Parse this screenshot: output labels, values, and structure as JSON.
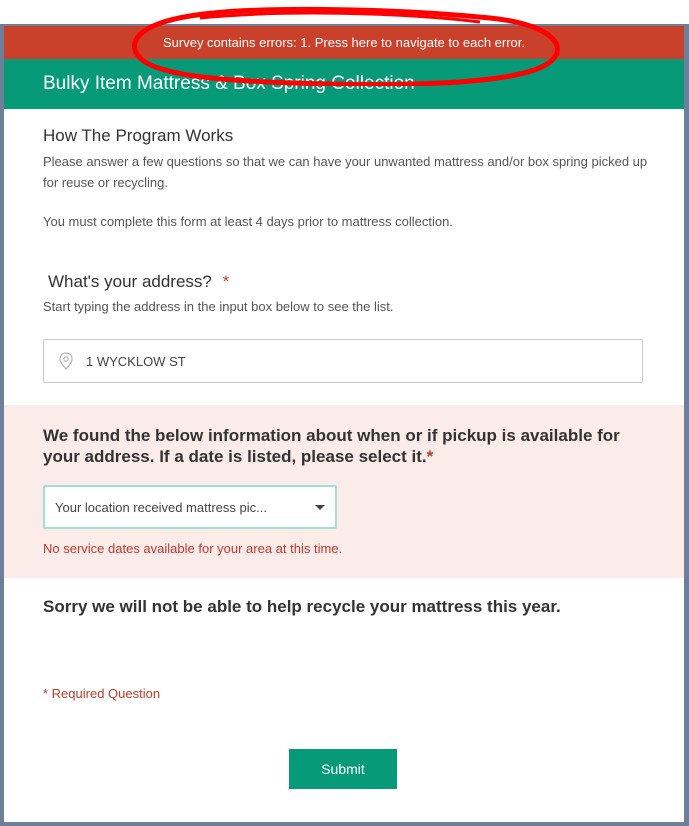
{
  "banner": {
    "error_text": "Survey contains errors: 1. Press here to navigate to each error."
  },
  "header": {
    "title": "Bulky Item Mattress & Box Spring Collection"
  },
  "intro": {
    "heading": "How The Program Works",
    "paragraph1": "Please answer a few questions so that we can have your unwanted mattress and/or box spring picked up for reuse or recycling.",
    "paragraph2": "You must complete this form at least 4 days prior to mattress collection."
  },
  "address_question": {
    "label": "What's your address?",
    "required_mark": "*",
    "hint": "Start typing the address in the input box below to see the list.",
    "value": "1 WYCKLOW ST",
    "icon": "map-pin-icon"
  },
  "pickup_question": {
    "label": "We found the below information about when or if pickup is available for your address. If a date is listed, please select it.",
    "required_mark": "*",
    "selected_value": "Your location received mattress pic...",
    "error_text": "No service dates available for your area at this time."
  },
  "sorry_message": "Sorry we will not be able to help recycle your mattress this year.",
  "footer": {
    "required_note": "* Required Question",
    "submit_label": "Submit"
  },
  "colors": {
    "error_red": "#c9412b",
    "brand_green": "#069a78",
    "error_panel": "#fbecea",
    "annotation_red": "#ff0000"
  }
}
